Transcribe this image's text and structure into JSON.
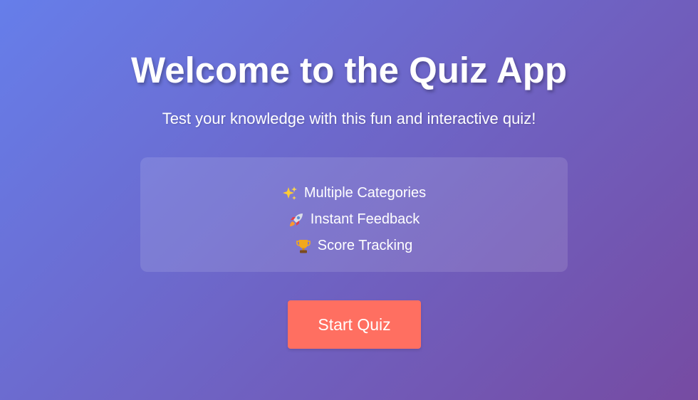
{
  "header": {
    "title": "Welcome to the Quiz App",
    "subtitle": "Test your knowledge with this fun and interactive quiz!"
  },
  "features": [
    {
      "icon": "sparkles-icon",
      "label": "Multiple Categories"
    },
    {
      "icon": "rocket-icon",
      "label": "Instant Feedback"
    },
    {
      "icon": "trophy-icon",
      "label": "Score Tracking"
    }
  ],
  "actions": {
    "start_label": "Start Quiz"
  },
  "colors": {
    "background_start": "#667eea",
    "background_end": "#764ba2",
    "button": "#ff6f61",
    "text": "#ffffff"
  }
}
